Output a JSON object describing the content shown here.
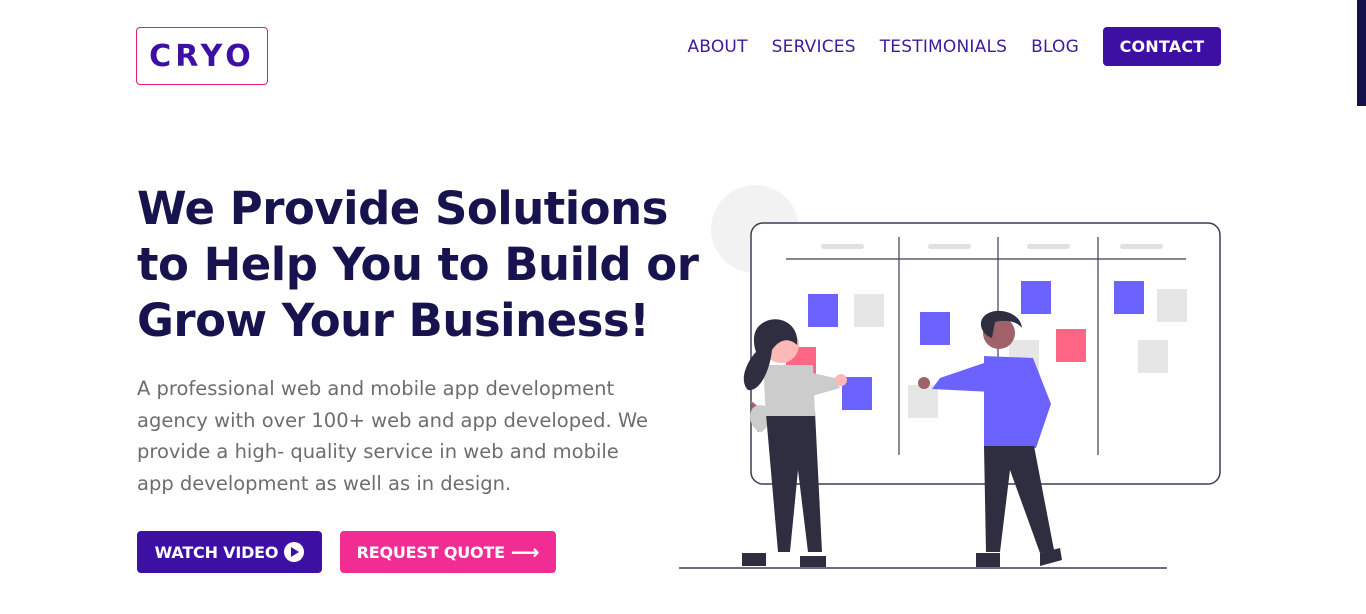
{
  "logo": {
    "text": "CRYO"
  },
  "nav": {
    "items": [
      "ABOUT",
      "SERVICES",
      "TESTIMONIALS",
      "BLOG"
    ],
    "contact_label": "CONTACT"
  },
  "hero": {
    "title_lines": [
      "We Provide Solutions",
      "to Help You to Build or",
      "Grow Your Business!"
    ],
    "description_lines": [
      "A professional web and mobile app development",
      "agency with over 100+ web and app developed. We",
      "provide a high- quality service in web and mobile",
      "app development as well as in design."
    ],
    "watch_video_label": "WATCH VIDEO",
    "watch_video_icon": "play-circle-icon",
    "request_quote_label": "REQUEST QUOTE",
    "request_quote_icon": "arrow-right-icon",
    "arrow_glyph": "⟶"
  },
  "colors": {
    "brand": "#3d0fa3",
    "accent": "#f12d94",
    "heading": "#16134f",
    "body_text": "#6d6d6d",
    "illustration_purple": "#6c63ff",
    "illustration_pink": "#ff6584"
  }
}
